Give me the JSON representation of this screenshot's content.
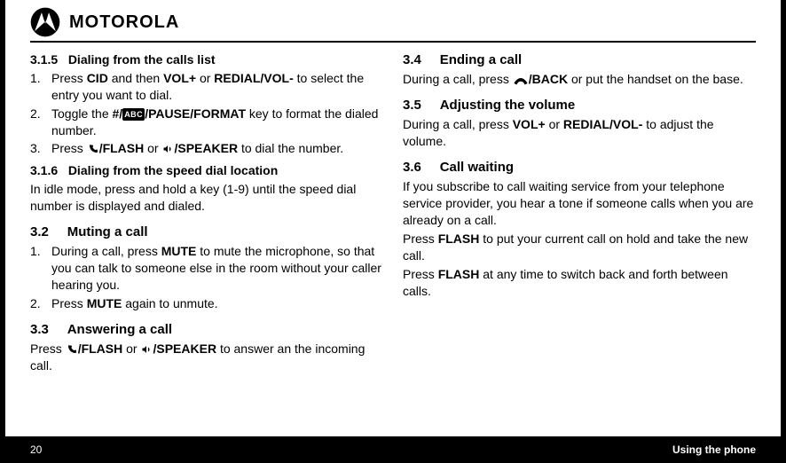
{
  "brand": "MOTOROLA",
  "left": {
    "s315": {
      "num": "3.1.5",
      "title": "Dialing from the calls list",
      "step1a": "Press ",
      "step1_cid": "CID",
      "step1b": " and then ",
      "step1_vol": "VOL+",
      "step1c": " or ",
      "step1_redial": "REDIAL/VOL-",
      "step1d": " to select the entry you want to dial.",
      "step2a": "Toggle the ",
      "step2_hash": "#/",
      "step2_abc": "ABC",
      "step2_pause": "/PAUSE/FORMAT",
      "step2b": " key to format the dialed number.",
      "step3a": "Press ",
      "step3_flash": "/FLASH",
      "step3b": " or ",
      "step3_speaker": "/SPEAKER",
      "step3c": " to dial the number."
    },
    "s316": {
      "num": "3.1.6",
      "title": "Dialing from the speed dial location",
      "body": "In idle mode, press and hold a key (1-9) until the speed dial number is displayed and dialed."
    },
    "s32": {
      "num": "3.2",
      "title": "Muting a call",
      "step1a": "During a call, press ",
      "step1_mute": "MUTE",
      "step1b": " to mute the microphone, so that you can talk to someone else in the room without your caller hearing you.",
      "step2a": "Press ",
      "step2_mute": "MUTE",
      "step2b": " again to unmute."
    },
    "s33": {
      "num": "3.3",
      "title": "Answering a call",
      "body_a": "Press ",
      "body_flash": "/FLASH",
      "body_b": " or ",
      "body_speaker": "/SPEAKER",
      "body_c": " to answer an the incoming call."
    }
  },
  "right": {
    "s34": {
      "num": "3.4",
      "title": "Ending a call",
      "body_a": "During a call, press ",
      "body_back": "/BACK",
      "body_b": " or put the handset on the base."
    },
    "s35": {
      "num": "3.5",
      "title": "Adjusting the volume",
      "body_a": "During a call, press ",
      "body_vol": "VOL+",
      "body_b": " or ",
      "body_redial": "REDIAL/VOL-",
      "body_c": " to adjust the volume."
    },
    "s36": {
      "num": "3.6",
      "title": "Call waiting",
      "p1": "If you subscribe to call waiting service from your telephone service provider, you hear a tone if someone calls when you are already on a call.",
      "p2a": "Press ",
      "p2_flash": "FLASH",
      "p2b": " to put your current call on hold and take the new call.",
      "p3a": "Press ",
      "p3_flash": "FLASH",
      "p3b": " at any time to switch back and forth between calls."
    }
  },
  "footer": {
    "page": "20",
    "section": "Using the phone"
  }
}
